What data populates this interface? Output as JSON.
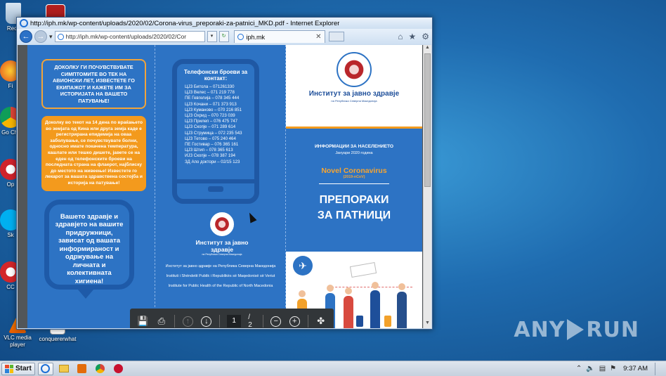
{
  "desktop": {
    "icons": [
      {
        "label": "Recy",
        "name": "recycle-bin-icon"
      },
      {
        "label": "Fi",
        "name": "firefox-icon"
      },
      {
        "label": "Go Chr",
        "name": "chrome-icon"
      },
      {
        "label": "Op",
        "name": "opera-icon"
      },
      {
        "label": "Sk",
        "name": "skype-icon"
      },
      {
        "label": "CC",
        "name": "ccleaner-icon"
      },
      {
        "label": "VLC media player",
        "name": "vlc-icon"
      },
      {
        "label": "conquererwhat",
        "name": "file-icon"
      }
    ],
    "watermark_left": "ANY",
    "watermark_right": "RUN"
  },
  "ie": {
    "title": "http://iph.mk/wp-content/uploads/2020/02/Corona-virus_preporaki-za-patnici_MKD.pdf - Internet Explorer",
    "address": "http://iph.mk/wp-content/uploads/2020/02/Cor",
    "tab_label": "iph.mk",
    "tab_close": "✕",
    "back": "←",
    "forward": "→",
    "dropdown": "▾",
    "refresh": "↻",
    "home_icon": "⌂",
    "favorites_icon": "★",
    "tools_icon": "⚙"
  },
  "pdf": {
    "panel1": {
      "box_outline": "Доколку ги почувствувате симптомите во тек на авионски лет, известете го екипажот и кажете им за историјата на вашето патување!",
      "box_orange": "Доколку во текот на 14 дена по враќањето во земјата од Кина или друга земја каде е регистрирана епидемија на оваа заболување, се почувствувате болни, односно имате покачена температура, кашлате или тешко дишете, јавете се на еден од телефонските броеви на последната страна на флаерот, најблиску до местото на живеење! Известете го лекарот за вашата здравствена состојба и историја на патување!",
      "bubble": "Вашето здравје и здравјето на вашите придружници, зависат од вашата информираност и одржување на личната и колективната хигиена!"
    },
    "panel2": {
      "phone_title": "Телефонски броеви за контакт:",
      "phone_numbers": [
        "ЦЈЗ Битола – 071261330",
        "ЦЈЗ Велес – 071 219 778",
        "ПЕ Гевгелија – 078 345 444",
        "ЦЈЗ Кочани – 071 373 913",
        "ЦЈЗ Куманово – 070 216 851",
        "ЦЈЗ Охрид – 070 723 039",
        "ЦЈЗ Прилеп – 076 475 747",
        "ЦЈЗ Скопје – 071 289 614",
        "ЦЈЗ Струмица – 072 235 543",
        "ЦЈЗ Тетово – 075 240 464",
        "ПЕ Гостивар – 076 365 161",
        "ЦЈЗ Штип – 078 365 613",
        "ИЈЗ Скопје – 078 387 194",
        "ЗД Апо доктори – 02/15 123"
      ],
      "org": "Институт за јавно здравје",
      "org_sub": "на Република Северна Македонија",
      "footer_lines": [
        "Институт за јавно здравје на Република Северна Македонија",
        "Instituti i Shëndetit Publik i Republikës së Maqedonisë së Veriut",
        "Institute for Public Health of the Republic of North Macedonia"
      ]
    },
    "panel3": {
      "org": "Институт за јавно здравје",
      "org_sub": "на Република Северна Македонија",
      "info": "ИНФОРМАЦИИ ЗА НАСЕЛЕНИЕТО",
      "date": "Јануари 2020 година",
      "virus": "Novel Coronavirus",
      "ncov": "(2019-nCoV)",
      "headline_1": "ПРЕПОРАКИ",
      "headline_2": "ЗА ПАТНИЦИ",
      "plane_icon": "✈"
    },
    "toolbar": {
      "current_page": "1",
      "total_pages": "/ 2"
    }
  },
  "taskbar": {
    "start_label": "Start",
    "clock": "9:37 AM"
  }
}
